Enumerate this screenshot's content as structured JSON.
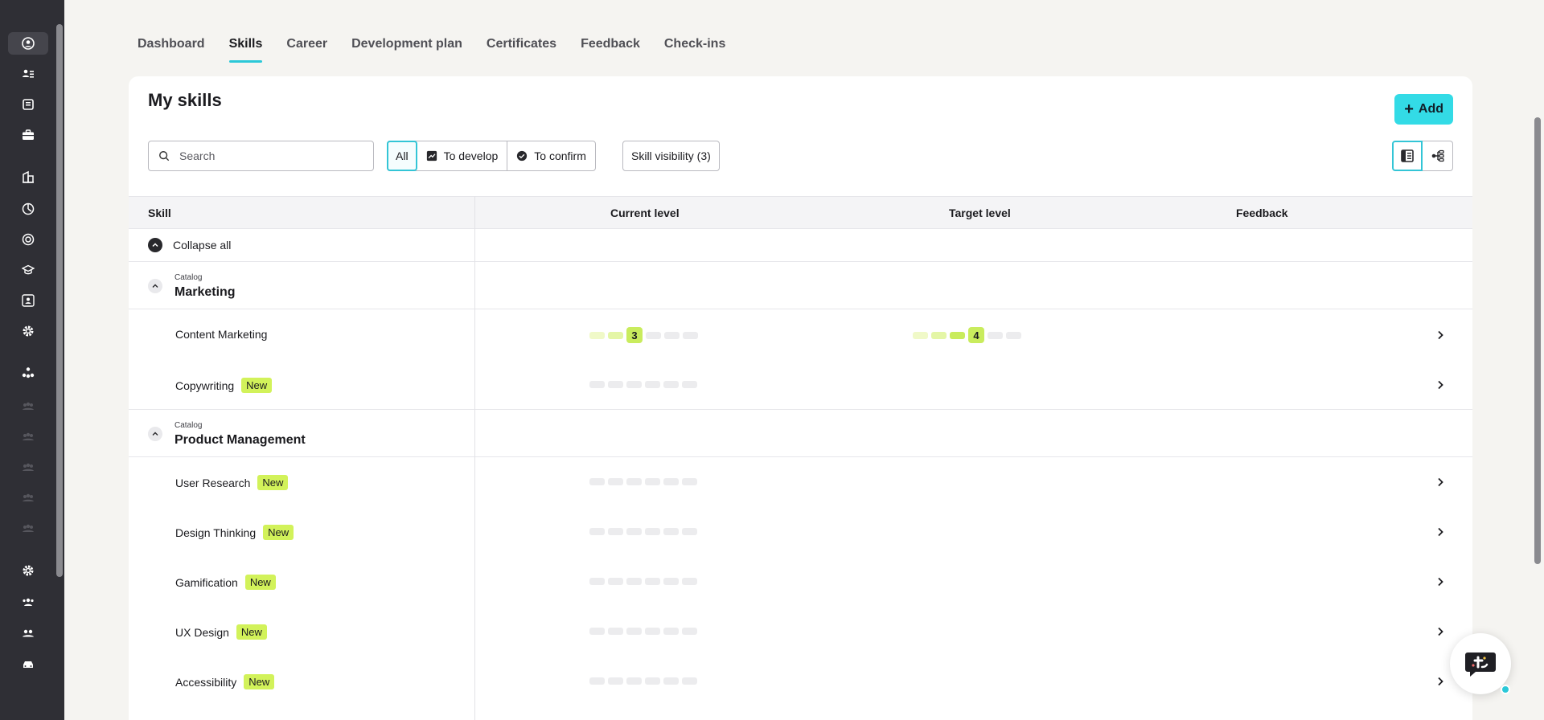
{
  "colors": {
    "accent": "#33dbe6",
    "sidebar": "#2f2f35",
    "badge": "#d2f25a",
    "level_fill": "#c9ec5d"
  },
  "sidebar": {
    "icons": [
      "profile-icon",
      "people-list-icon",
      "document-icon",
      "briefcase-icon",
      "building-icon",
      "chart-icon",
      "target-icon",
      "graduation-icon",
      "team-icon",
      "settings-icon",
      "org-icon",
      "group-icon",
      "group-icon",
      "group-icon",
      "group-icon",
      "group-icon",
      "settings-icon",
      "team-icon",
      "group-icon",
      "car-icon"
    ]
  },
  "tabs": [
    "Dashboard",
    "Skills",
    "Career",
    "Development plan",
    "Certificates",
    "Feedback",
    "Check-ins"
  ],
  "active_tab": "Skills",
  "page": {
    "title": "My skills",
    "add_label": "Add",
    "search_placeholder": "Search",
    "filters": [
      "All",
      "To develop",
      "To confirm"
    ],
    "active_filter": "All",
    "visibility_label": "Skill visibility (3)"
  },
  "table": {
    "headers": {
      "skill": "Skill",
      "current": "Current level",
      "target": "Target level",
      "feedback": "Feedback"
    },
    "collapse_all": "Collapse all",
    "groups": [
      {
        "label": "Catalog",
        "name": "Marketing",
        "skills": [
          {
            "name": "Content Marketing",
            "badge": "",
            "current_level": 3,
            "target_level": 4
          },
          {
            "name": "Copywriting",
            "badge": "New",
            "current_level": 0,
            "target_level": 0
          }
        ]
      },
      {
        "label": "Catalog",
        "name": "Product Management",
        "skills": [
          {
            "name": "User Research",
            "badge": "New",
            "current_level": 0,
            "target_level": 0
          },
          {
            "name": "Design Thinking",
            "badge": "New",
            "current_level": 0,
            "target_level": 0
          },
          {
            "name": "Gamification",
            "badge": "New",
            "current_level": 0,
            "target_level": 0
          },
          {
            "name": "UX Design",
            "badge": "New",
            "current_level": 0,
            "target_level": 0
          },
          {
            "name": "Accessibility",
            "badge": "New",
            "current_level": 0,
            "target_level": 0
          }
        ]
      }
    ],
    "max_level": 6
  }
}
